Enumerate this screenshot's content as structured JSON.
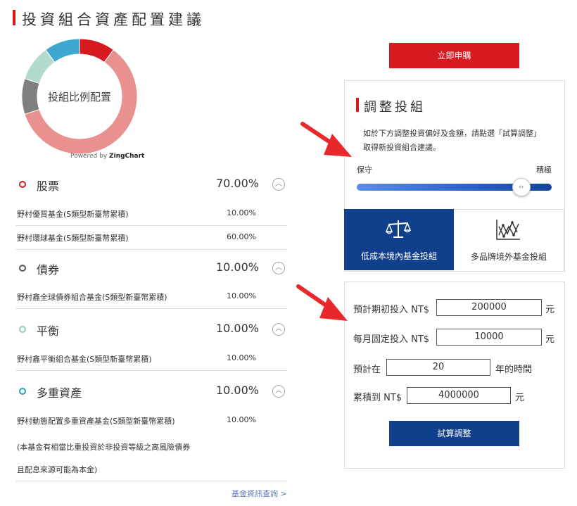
{
  "page_title": "投資組合資產配置建議",
  "chart_data": {
    "type": "pie",
    "center_label": "投組比例配置",
    "credit": {
      "prefix": "Powered by",
      "brand": "ZingChart"
    },
    "categories": [
      "股票",
      "債券",
      "平衡",
      "多重資產"
    ],
    "values": [
      70,
      10,
      10,
      10
    ],
    "colors": [
      "#e8918f",
      "#7f7f7f",
      "#b2dace",
      "#3ea7cf"
    ],
    "highlight_color": "#d71920"
  },
  "categories": [
    {
      "name": "股票",
      "pct": "70.00%",
      "dot_color": "#d71920",
      "funds": [
        {
          "name": "野村優質基金(S類型新臺幣累積)",
          "pct": "10.00%"
        },
        {
          "name": "野村環球基金(S類型新臺幣累積)",
          "pct": "60.00%"
        }
      ]
    },
    {
      "name": "債券",
      "pct": "10.00%",
      "dot_color": "#555555",
      "funds": [
        {
          "name": "野村鑫全球債券組合基金(S類型新臺幣累積)",
          "pct": "10.00%"
        }
      ]
    },
    {
      "name": "平衡",
      "pct": "10.00%",
      "dot_color": "#8fcfb9",
      "funds": [
        {
          "name": "野村鑫平衡組合基金(S類型新臺幣累積)",
          "pct": "10.00%"
        }
      ]
    },
    {
      "name": "多重資產",
      "pct": "10.00%",
      "dot_color": "#1f9bd1",
      "funds": [
        {
          "name": "野村動態配置多重資產基金(S類型新臺幣累積)",
          "pct": "10.00%"
        }
      ]
    }
  ],
  "note_line1": "(本基金有相當比重投資於非投資等級之高風險債券",
  "note_line2": "且配息來源可能為本金)",
  "fund_info_link": "基金資訊查詢 >",
  "apply_button": "立即申購",
  "adjust": {
    "title": "調整投組",
    "description": "如於下方調整投資偏好及金額，請點選「試算調整」取得新投資組合建議。",
    "slider_left": "保守",
    "slider_right": "積極",
    "slider_value_fraction": 0.84,
    "thumb_symbol": "‹›"
  },
  "options": [
    {
      "label": "低成本境內基金投組",
      "icon": "balance-scale-icon",
      "selected": true
    },
    {
      "label": "多品牌境外基金投組",
      "icon": "line-chart-icon",
      "selected": false
    }
  ],
  "form": {
    "initial_label": "預計期初投入 NT$",
    "initial_value": "200000",
    "initial_unit": "元",
    "monthly_label": "每月固定投入 NT$",
    "monthly_value": "10000",
    "monthly_unit": "元",
    "years_label": "預計在",
    "years_value": "20",
    "years_unit": "年的時間",
    "target_label": "累積到 NT$",
    "target_value": "4000000",
    "target_unit": "元"
  },
  "calc_button": "試算調整",
  "colors": {
    "accent_red": "#d71920",
    "navy": "#103f8c",
    "arrow_red": "#e8282b"
  }
}
